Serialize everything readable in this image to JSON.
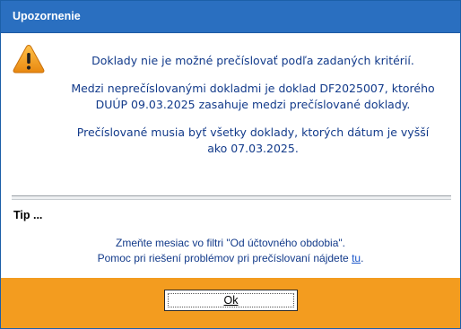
{
  "window": {
    "title": "Upozornenie"
  },
  "icons": {
    "warning": "warning-triangle-icon"
  },
  "message": {
    "line1": "Doklady nie je možné prečíslovať podľa zadaných kritérií.",
    "line2a": "Medzi neprečíslovanými dokladmi je doklad DF2025007, ktorého",
    "line2b": "DUÚP 09.03.2025 zasahuje medzi prečíslované doklady.",
    "line3a": "Prečíslované musia byť všetky doklady, ktorých dátum je vyšší",
    "line3b": "ako 07.03.2025."
  },
  "tip": {
    "heading": "Tip ...",
    "line1": "Zmeňte mesiac vo filtri \"Od účtovného obdobia\".",
    "line2_prefix": "Pomoc pri riešení problémov pri prečíslovaní nájdete ",
    "link_text": "tu",
    "line2_suffix": "."
  },
  "buttons": {
    "ok_label": "Ok"
  },
  "colors": {
    "titlebar": "#2a6fc0",
    "footer": "#f39c1f",
    "message_text": "#123a8a",
    "warning_fill": "#f0a020"
  }
}
